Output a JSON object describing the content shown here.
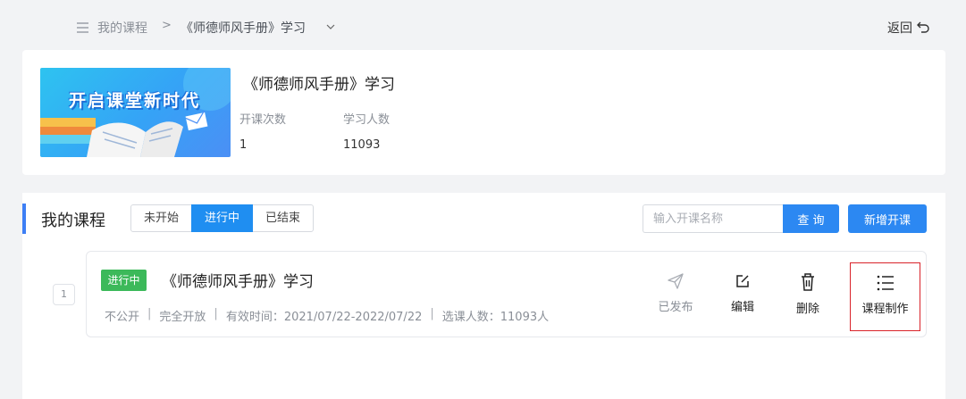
{
  "breadcrumb": {
    "home": "我的课程",
    "separator": ">",
    "current": "《师德师风手册》学习",
    "back": "返回"
  },
  "course": {
    "cover_text": "开启课堂新时代",
    "title": "《师德师风手册》学习",
    "stats": [
      {
        "label": "开课次数",
        "value": "1"
      },
      {
        "label": "学习人数",
        "value": "11093"
      }
    ]
  },
  "panel": {
    "title": "我的课程",
    "tabs": [
      {
        "label": "未开始"
      },
      {
        "label": "进行中"
      },
      {
        "label": "已结束"
      }
    ],
    "active_tab": "进行中",
    "search_placeholder": "输入开课名称",
    "search_button": "查 询",
    "add_button": "新增开课"
  },
  "rows": [
    {
      "index": "1",
      "status": "进行中",
      "title": "《师德师风手册》学习",
      "meta": {
        "visibility": "不公开",
        "open_mode": "完全开放",
        "valid_period": "有效时间：2021/07/22-2022/07/22",
        "enrolled": "选课人数：11093人"
      },
      "actions": {
        "published": "已发布",
        "edit": "编辑",
        "delete": "删除",
        "make": "课程制作"
      }
    }
  ],
  "colors": {
    "accent": "#2c88f2",
    "status_green": "#3cb95a",
    "highlight_border": "#d9232a"
  }
}
